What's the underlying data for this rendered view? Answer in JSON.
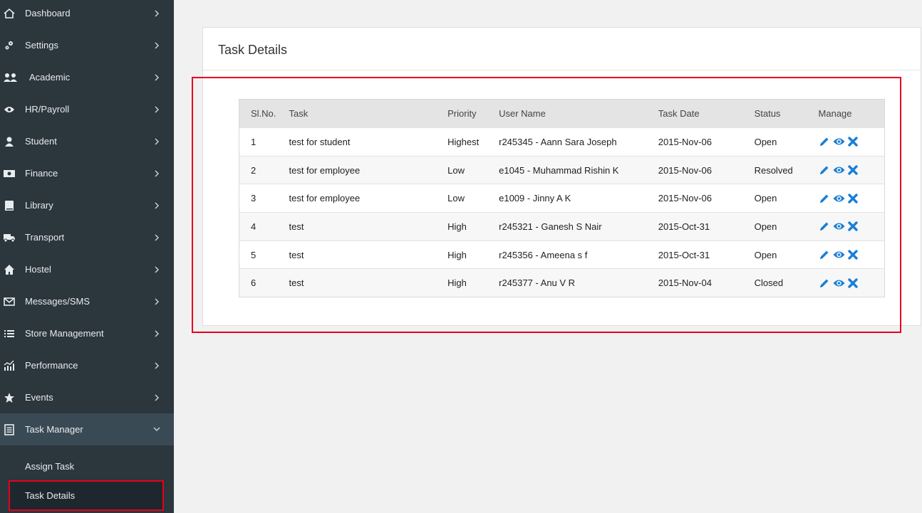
{
  "sidebar": {
    "items": [
      {
        "label": "Dashboard",
        "icon": "home-icon"
      },
      {
        "label": "Settings",
        "icon": "gears-icon"
      },
      {
        "label": "Academic",
        "icon": "users-icon"
      },
      {
        "label": "HR/Payroll",
        "icon": "eye-icon"
      },
      {
        "label": "Student",
        "icon": "user-icon"
      },
      {
        "label": "Finance",
        "icon": "money-icon"
      },
      {
        "label": "Library",
        "icon": "book-icon"
      },
      {
        "label": "Transport",
        "icon": "truck-icon"
      },
      {
        "label": "Hostel",
        "icon": "home-icon"
      },
      {
        "label": "Messages/SMS",
        "icon": "envelope-icon"
      },
      {
        "label": "Store Management",
        "icon": "list-icon"
      },
      {
        "label": "Performance",
        "icon": "chart-icon"
      },
      {
        "label": "Events",
        "icon": "star-icon"
      },
      {
        "label": "Task Manager",
        "icon": "document-icon"
      }
    ],
    "subitems": [
      {
        "label": "Assign Task"
      },
      {
        "label": "Task Details"
      }
    ]
  },
  "panel": {
    "title": "Task Details"
  },
  "table": {
    "headers": [
      "Sl.No.",
      "Task",
      "Priority",
      "User Name",
      "Task Date",
      "Status",
      "Manage"
    ],
    "rows": [
      {
        "sl": "1",
        "task": "test for student",
        "priority": "Highest",
        "user": "r245345 - Aann Sara Joseph",
        "date": "2015-Nov-06",
        "status": "Open"
      },
      {
        "sl": "2",
        "task": "test for employee",
        "priority": "Low",
        "user": "e1045 - Muhammad Rishin K",
        "date": "2015-Nov-06",
        "status": "Resolved"
      },
      {
        "sl": "3",
        "task": "test for employee",
        "priority": "Low",
        "user": "e1009 - Jinny A K",
        "date": "2015-Nov-06",
        "status": "Open"
      },
      {
        "sl": "4",
        "task": "test",
        "priority": "High",
        "user": "r245321 - Ganesh S Nair",
        "date": "2015-Oct-31",
        "status": "Open"
      },
      {
        "sl": "5",
        "task": "test",
        "priority": "High",
        "user": "r245356 - Ameena s f",
        "date": "2015-Oct-31",
        "status": "Open"
      },
      {
        "sl": "6",
        "task": "test",
        "priority": "High",
        "user": "r245377 - Anu V R",
        "date": "2015-Nov-04",
        "status": "Closed"
      }
    ]
  },
  "colors": {
    "sidebar_bg": "#2b363d",
    "active_bg": "#3a4a55",
    "accent_blue": "#1a7fd6",
    "highlight_red": "#e8001c"
  }
}
